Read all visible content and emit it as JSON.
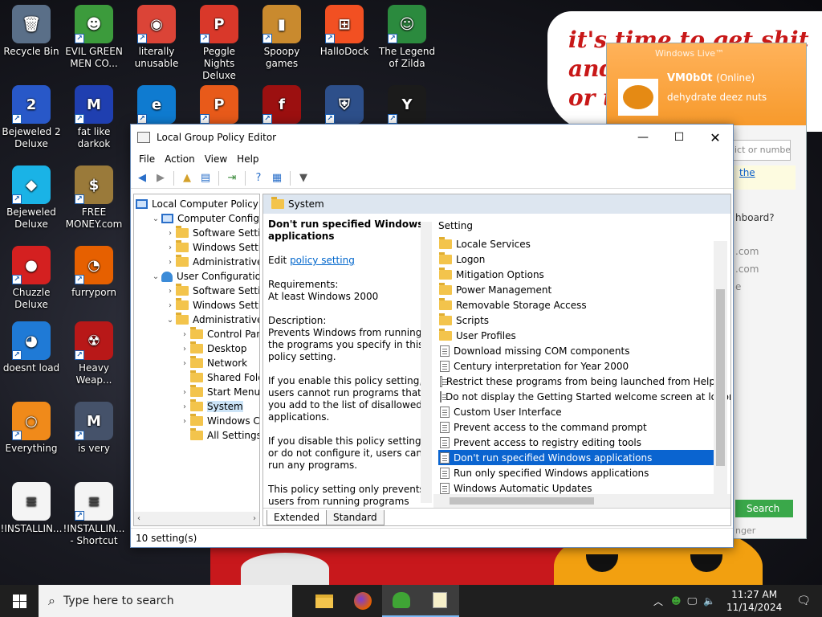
{
  "desktop": {
    "icons": [
      {
        "label": "Recycle Bin",
        "glyph": "🗑",
        "color": "#5a6f88"
      },
      {
        "label": "EVIL GREEN MEN CO...",
        "glyph": "☻",
        "color": "#3c9b3c"
      },
      {
        "label": "literally unusable",
        "glyph": "◉",
        "color": "#db4437"
      },
      {
        "label": "Peggle Nights Deluxe",
        "glyph": "P",
        "color": "#d9382a"
      },
      {
        "label": "Spoopy games",
        "glyph": "▮",
        "color": "#c98a2e"
      },
      {
        "label": "HalloDock",
        "glyph": "⊞",
        "color": "#f25022"
      },
      {
        "label": "The Legend of Zilda",
        "glyph": "☺",
        "color": "#2b8a3e"
      },
      {
        "label": "Bejeweled 2 Deluxe",
        "glyph": "2",
        "color": "#2858c8"
      },
      {
        "label": "fat like darkok",
        "glyph": "M",
        "color": "#1f3fb0"
      },
      {
        "label": "",
        "glyph": "e",
        "color": "#0f7bd0"
      },
      {
        "label": "",
        "glyph": "P",
        "color": "#e85a1a"
      },
      {
        "label": "",
        "glyph": "f",
        "color": "#9c1010"
      },
      {
        "label": "",
        "glyph": "⛨",
        "color": "#2d4f8a"
      },
      {
        "label": "",
        "glyph": "Y",
        "color": "#1b1b1b"
      },
      {
        "label": "Bejeweled Deluxe",
        "glyph": "◆",
        "color": "#1ab3e6"
      },
      {
        "label": "FREE MONEY.com",
        "glyph": "$",
        "color": "#9a7a3a"
      },
      {
        "label": "Chuzzle Deluxe",
        "glyph": "●",
        "color": "#d42020"
      },
      {
        "label": "furryporn",
        "glyph": "◔",
        "color": "#e66000"
      },
      {
        "label": "doesnt load",
        "glyph": "◕",
        "color": "#1f7ad6"
      },
      {
        "label": "Heavy Weap...",
        "glyph": "☢",
        "color": "#b81818"
      },
      {
        "label": "Everything",
        "glyph": "○",
        "color": "#f08a1a"
      },
      {
        "label": "is very",
        "glyph": "M",
        "color": "#45526a"
      },
      {
        "label": "!INSTALLIN...",
        "glyph": "≡",
        "color": "#f4f4f4"
      },
      {
        "label": "!INSTALLIN... - Shortcut",
        "glyph": "≡",
        "color": "#f4f4f4"
      }
    ],
    "wallpaper_text": "it's time to get shit\nand\nor t"
  },
  "messenger": {
    "title": "Windows Live™",
    "username": "VM0b0t",
    "status": "(Online)",
    "message": "dehydrate deez nuts",
    "search_placeholder": "ict or numbe",
    "link_text": "the",
    "body_lines": [
      "hboard?",
      ".com",
      ".com",
      "e"
    ],
    "search_button": "Search",
    "footer": "nger"
  },
  "window": {
    "title": "Local Group Policy Editor",
    "menu": [
      "File",
      "Action",
      "View",
      "Help"
    ],
    "tree": [
      {
        "label": "Local Computer Policy",
        "indent": 0,
        "arrow": "",
        "icon": "pc"
      },
      {
        "label": "Computer Configura",
        "indent": 1,
        "arrow": "⌄",
        "icon": "pc"
      },
      {
        "label": "Software Settings",
        "indent": 2,
        "arrow": "›",
        "icon": "folder"
      },
      {
        "label": "Windows Setting",
        "indent": 2,
        "arrow": "›",
        "icon": "folder"
      },
      {
        "label": "Administrative Te",
        "indent": 2,
        "arrow": "›",
        "icon": "folder"
      },
      {
        "label": "User Configuration",
        "indent": 1,
        "arrow": "⌄",
        "icon": "user"
      },
      {
        "label": "Software Settings",
        "indent": 2,
        "arrow": "›",
        "icon": "folder"
      },
      {
        "label": "Windows Setting",
        "indent": 2,
        "arrow": "›",
        "icon": "folder"
      },
      {
        "label": "Administrative Te",
        "indent": 2,
        "arrow": "⌄",
        "icon": "folder"
      },
      {
        "label": "Control Panel",
        "indent": 3,
        "arrow": "›",
        "icon": "folder"
      },
      {
        "label": "Desktop",
        "indent": 3,
        "arrow": "›",
        "icon": "folder"
      },
      {
        "label": "Network",
        "indent": 3,
        "arrow": "›",
        "icon": "folder"
      },
      {
        "label": "Shared Folder",
        "indent": 3,
        "arrow": "",
        "icon": "folder"
      },
      {
        "label": "Start Menu ar",
        "indent": 3,
        "arrow": "›",
        "icon": "folder"
      },
      {
        "label": "System",
        "indent": 3,
        "arrow": "›",
        "icon": "folder",
        "selected": true
      },
      {
        "label": "Windows Cor",
        "indent": 3,
        "arrow": "›",
        "icon": "folder"
      },
      {
        "label": "All Settings",
        "indent": 3,
        "arrow": "",
        "icon": "folder"
      }
    ],
    "header": "System",
    "description": {
      "title": "Don't run specified Windows applications",
      "edit_prefix": "Edit ",
      "edit_link": "policy setting ",
      "requirements_label": "Requirements:",
      "requirements_value": "At least Windows 2000",
      "description_label": "Description:",
      "p1": "Prevents Windows from running the programs you specify in this policy setting.",
      "p2": "If you enable this policy setting, users cannot run programs that you add to the list of disallowed applications.",
      "p3": "If you disable this policy setting or do not configure it, users can run any programs.",
      "p4": "This policy setting only prevents users from running programs that"
    },
    "list_header": "Setting",
    "settings": [
      {
        "label": "Locale Services",
        "type": "folder"
      },
      {
        "label": "Logon",
        "type": "folder"
      },
      {
        "label": "Mitigation Options",
        "type": "folder"
      },
      {
        "label": "Power Management",
        "type": "folder"
      },
      {
        "label": "Removable Storage Access",
        "type": "folder"
      },
      {
        "label": "Scripts",
        "type": "folder"
      },
      {
        "label": "User Profiles",
        "type": "folder"
      },
      {
        "label": "Download missing COM components",
        "type": "policy"
      },
      {
        "label": "Century interpretation for Year 2000",
        "type": "policy"
      },
      {
        "label": "Restrict these programs from being launched from Help",
        "type": "policy"
      },
      {
        "label": "Do not display the Getting Started welcome screen at logon",
        "type": "policy"
      },
      {
        "label": "Custom User Interface",
        "type": "policy"
      },
      {
        "label": "Prevent access to the command prompt",
        "type": "policy"
      },
      {
        "label": "Prevent access to registry editing tools",
        "type": "policy"
      },
      {
        "label": "Don't run specified Windows applications",
        "type": "policy",
        "selected": true
      },
      {
        "label": "Run only specified Windows applications",
        "type": "policy"
      },
      {
        "label": "Windows Automatic Updates",
        "type": "policy"
      }
    ],
    "tabs": [
      "Extended",
      "Standard"
    ],
    "status": "10 setting(s)"
  },
  "taskbar": {
    "search_placeholder": "Type here to search",
    "time": "11:27 AM",
    "date": "11/14/2024"
  }
}
